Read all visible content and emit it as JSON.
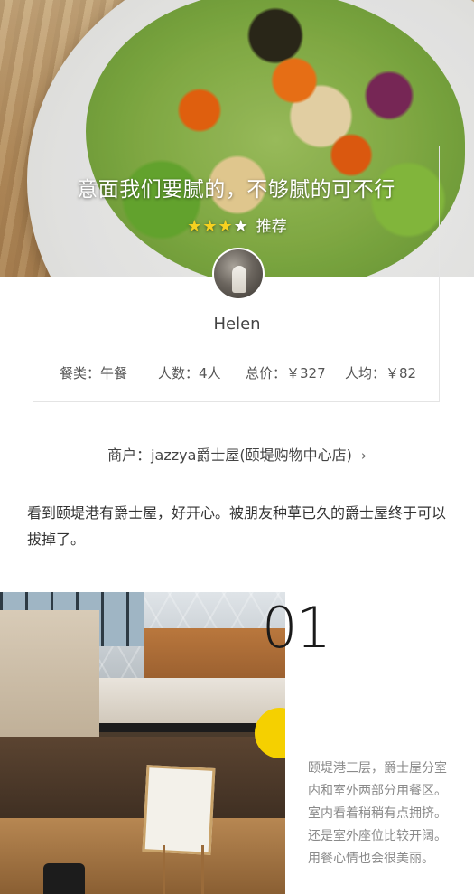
{
  "post": {
    "title": "意面我们要腻的，不够腻的可不行",
    "rating": {
      "value": 3,
      "max": 4,
      "label": "推荐"
    },
    "author": "Helen",
    "meta": {
      "category": "餐类：午餐",
      "people": "人数：4人",
      "total": "总价：￥327",
      "average": "人均：￥82"
    },
    "merchant": {
      "label": "商户：jazzya爵士屋(颐堤购物中心店)",
      "chevron": "›"
    },
    "intro": "看到颐堤港有爵士屋，好开心。被朋友种草已久的爵士屋终于可以拔掉了。"
  },
  "section": {
    "number": "01",
    "text": "颐堤港三层，爵士屋分室内和室外两部分用餐区。室内看着稍稍有点拥挤。还是室外座位比较开阔。用餐心情也会很美丽。"
  },
  "icons": {
    "star_filled": "star-icon",
    "star_empty": "star-outline-icon",
    "chevron": "chevron-right-icon"
  },
  "colors": {
    "star": "#f6d120",
    "text": "#333333",
    "muted": "#8a8a8a"
  }
}
